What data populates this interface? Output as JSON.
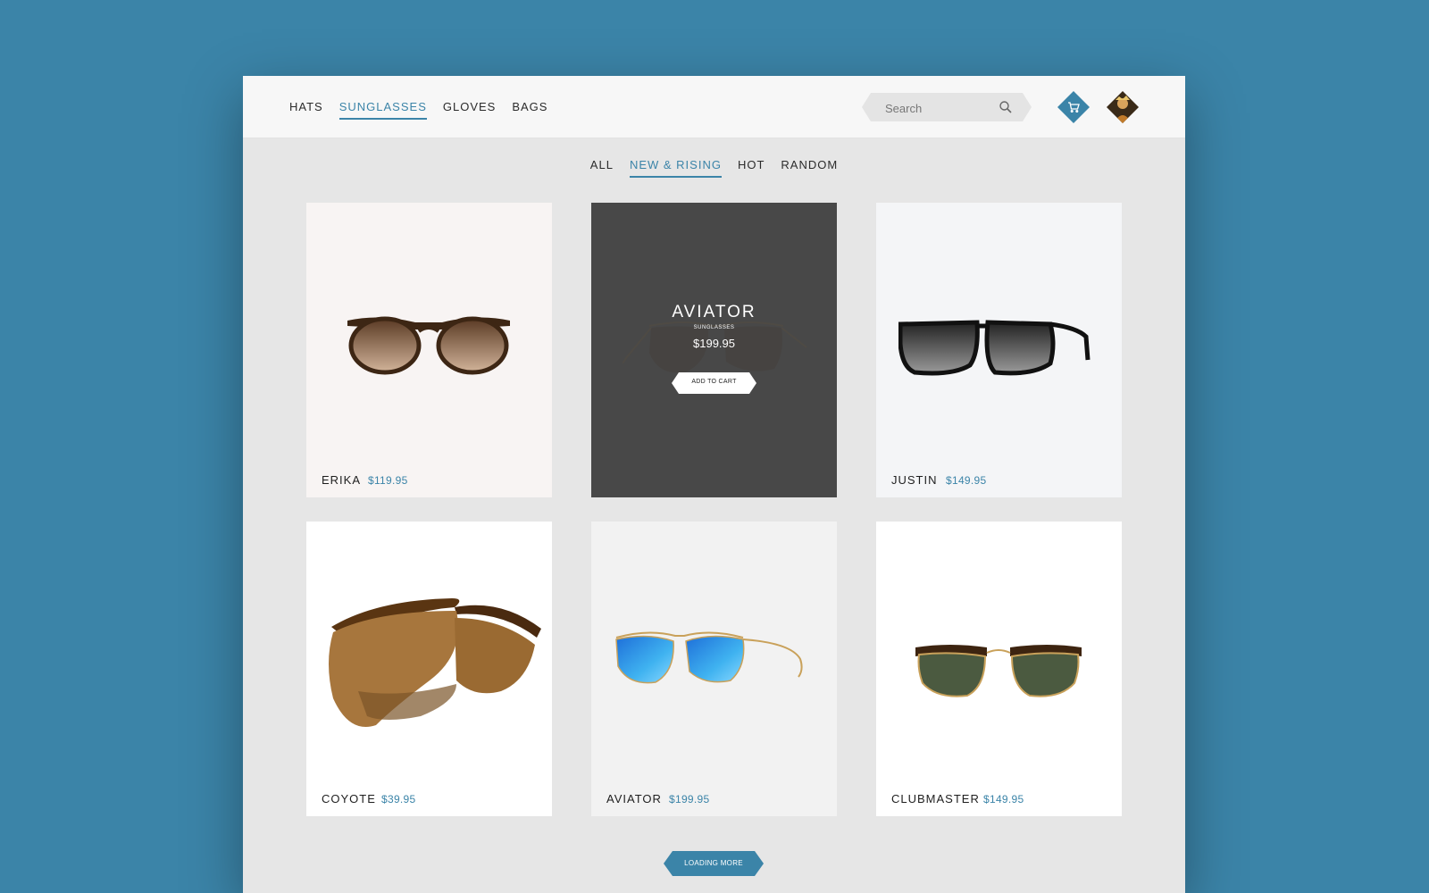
{
  "header": {
    "categories": [
      {
        "label": "HATS",
        "active": false
      },
      {
        "label": "SUNGLASSES",
        "active": true
      },
      {
        "label": "GLOVES",
        "active": false
      },
      {
        "label": "BAGS",
        "active": false
      }
    ],
    "search": {
      "placeholder": "Search",
      "icon": "search-icon"
    },
    "cart_icon": "cart-icon",
    "avatar": "user-avatar"
  },
  "filters": [
    {
      "label": "ALL",
      "active": false
    },
    {
      "label": "NEW & RISING",
      "active": true
    },
    {
      "label": "HOT",
      "active": false
    },
    {
      "label": "RANDOM",
      "active": false
    }
  ],
  "products": [
    {
      "name": "ERIKA",
      "price": "$119.95"
    },
    {
      "name": "AVIATOR",
      "price": "$199.95",
      "hover": true
    },
    {
      "name": "JUSTIN",
      "price": "$149.95"
    },
    {
      "name": "COYOTE",
      "price": "$39.95"
    },
    {
      "name": "AVIATOR",
      "price": "$199.95"
    },
    {
      "name": "CLUBMASTER",
      "price": "$149.95"
    }
  ],
  "hover_card": {
    "title": "AVIATOR",
    "subtitle": "SUNGLASSES",
    "price": "$199.95",
    "cta": "ADD TO CART"
  },
  "load_more": "LOADING MORE",
  "colors": {
    "accent": "#3b84a8",
    "page_bg": "#3b84a8",
    "content_bg": "#e6e6e6",
    "header_bg": "#f7f7f7"
  }
}
